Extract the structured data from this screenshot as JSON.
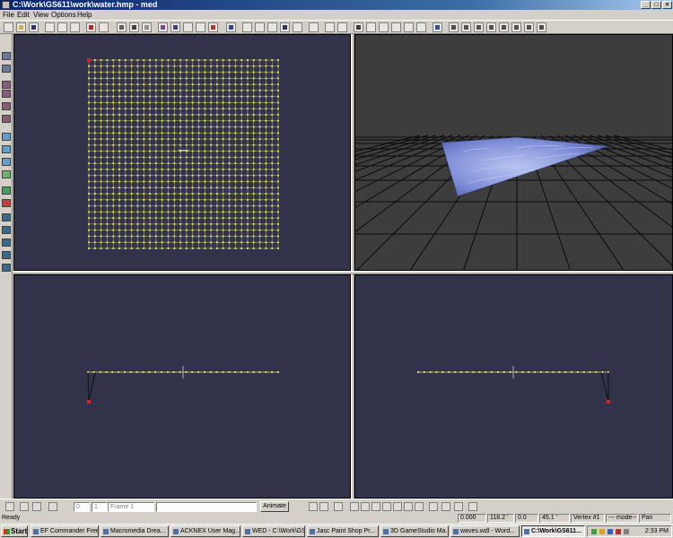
{
  "window": {
    "title": "C:\\Work\\GS611\\work\\water.hmp - med"
  },
  "menu": [
    "File",
    "Edit",
    "View",
    "Options",
    "Help"
  ],
  "colors": {
    "viewport_bg": "#32324a",
    "viewport3d_bg": "#3d3d3d",
    "vertex": "#d8d860",
    "selected_vertex": "#e02020",
    "water": "#8090d8"
  },
  "mesh": {
    "columns": 32,
    "rows": 32,
    "selected_vertex": "Vertex #1"
  },
  "animbar": {
    "frame_number": "0",
    "frame_total": "1",
    "frame_name": "Frame 1",
    "animate_label": "Animate"
  },
  "status": {
    "ready": "Ready",
    "x": "0.000",
    "y": "118.2 '",
    "z": "0.0",
    "zoom": "45.1 '",
    "vertex": "Vertex #1",
    "mode": "--- mode---",
    "tool": "Pan"
  },
  "taskbar": {
    "start_label": "Start",
    "tasks": [
      "EF Commander Free",
      "Macromedia Drea...",
      "ACKNEX User Mag...",
      "WED - C:\\Work\\GS...",
      "Jasc Paint Shop Pr...",
      "3D GameStudio Ma...",
      "waves.wdl - Word...",
      "C:\\Work\\GS611..."
    ],
    "active_task": 7,
    "clock": "2:33 PM"
  },
  "icons": {
    "toolbar": [
      "new-file-icon",
      "open-file-icon",
      "save-icon",
      "cut-icon",
      "copy-icon",
      "paste-icon",
      "undo-icon",
      "redo-icon",
      "view-mode-icon",
      "texture-mode-icon",
      "solid-mode-icon",
      "select-vertex-icon",
      "move-icon",
      "rotate-icon",
      "scale-icon",
      "delete-icon",
      "model-icon",
      "transform-icon",
      "vertex-tool-icon",
      "triangle-tool-icon",
      "bone-tool-icon",
      "smooth-icon",
      "grid-icon",
      "layout-4-icon",
      "layout-h-icon",
      "layout-v-icon",
      "view-front-icon",
      "view-side-icon",
      "view-top-icon",
      "help-icon",
      "frame-first-icon",
      "frame-prev-icon",
      "play-icon",
      "stop-icon",
      "frame-next-icon",
      "frame-last-icon",
      "loop-icon",
      "export-icon"
    ]
  }
}
